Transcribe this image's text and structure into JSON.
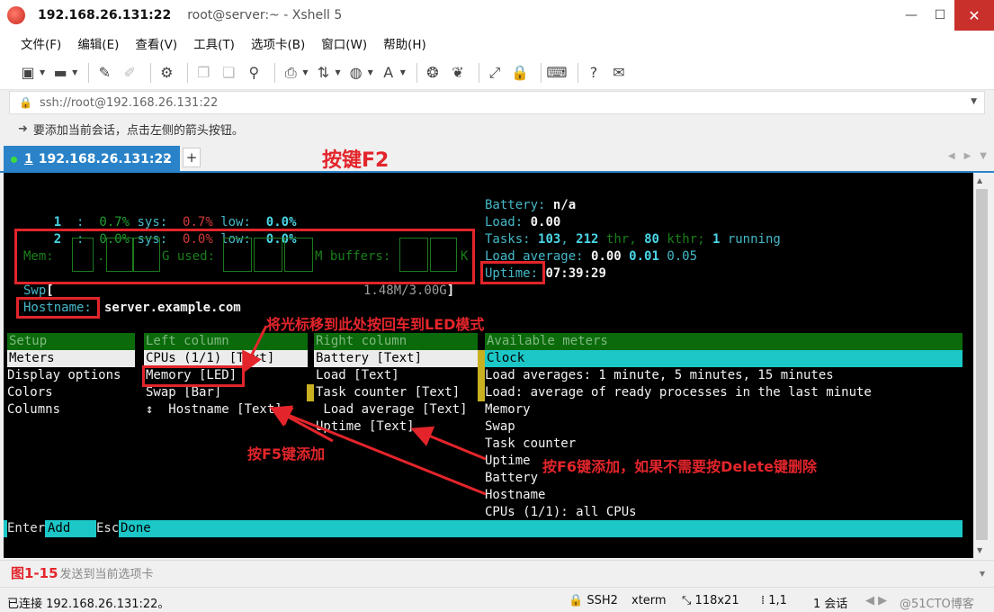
{
  "window": {
    "title_ip": "192.168.26.131:22",
    "title_rest": "root@server:~ - Xshell 5",
    "minimize": "—",
    "maximize": "☐",
    "close": "✕"
  },
  "menu": [
    "文件(F)",
    "编辑(E)",
    "查看(V)",
    "工具(T)",
    "选项卡(B)",
    "窗口(W)",
    "帮助(H)"
  ],
  "address": {
    "value": "ssh://root@192.168.26.131:22"
  },
  "hint": "要添加当前会话，点击左侧的箭头按钮。",
  "tab": {
    "number": "1",
    "label": "192.168.26.131:22",
    "close": "×",
    "add": "+"
  },
  "terminal": {
    "cpu1": {
      "idx": "1",
      "pct": "0.7%",
      "sys_label": "sys:",
      "sys_val": "0.7%",
      "low_label": "low:",
      "low_val": "0.0%"
    },
    "cpu2": {
      "idx": "2",
      "pct": "0.0%",
      "sys_label": "sys:",
      "sys_val": "0.0%",
      "low_label": "low:",
      "low_val": "0.0%"
    },
    "mem": {
      "label": "Mem:",
      "used_label": "G used:",
      "buffers_label": "M buffers:"
    },
    "swap": {
      "label": "Swp",
      "value": "1.48M/3.00G"
    },
    "hostname": {
      "label": "Hostname:",
      "value": "server.example.com"
    },
    "right": {
      "battery_label": "Battery:",
      "battery_val": "n/a",
      "load_label": "Load:",
      "load_val": "0.00",
      "tasks_label": "Tasks:",
      "tasks_val": "103",
      "thr_val": "212",
      "thr_label": "thr,",
      "kthr_val": "80",
      "kthr_label": "kthr;",
      "running_val": "1",
      "running_label": "running",
      "loadavg_label": "Load average:",
      "loadavg_1": "0.00",
      "loadavg_5": "0.01",
      "loadavg_15": "0.05",
      "uptime_label": "Uptime:",
      "uptime_val": "07:39:29"
    },
    "setup": {
      "headers": {
        "setup": "Setup",
        "left": "Left column",
        "right": "Right column",
        "available": "Available meters"
      },
      "setup_items": [
        "Meters",
        "Display options",
        "Colors",
        "Columns"
      ],
      "left_items": [
        "CPUs (1/1) [Text]",
        "Memory [LED]",
        "Swap [Bar]",
        "↕  Hostname [Text]"
      ],
      "right_items": [
        "Battery [Text]",
        "Load [Text]",
        "Task counter [Text]",
        " Load average [Text]",
        "Uptime [Text]"
      ],
      "available_items": [
        "Clock",
        "Load averages: 1 minute, 5 minutes, 15 minutes",
        "Load: average of ready processes in the last minute",
        "Memory",
        "Swap",
        "Task counter",
        "Uptime",
        "Battery",
        "Hostname",
        "CPUs (1/1): all CPUs"
      ]
    },
    "footer": {
      "enter_key": "Enter",
      "enter_label": "Add",
      "esc_key": "Esc",
      "esc_label": "Done"
    }
  },
  "annotations": {
    "f2": "按键F2",
    "led": "将光标移到此处按回车到LED模式",
    "f5": "按F5键添加",
    "f6": "按F6键添加，如果不需要按Delete键删除",
    "figure": "图1-15"
  },
  "compose": {
    "placeholder": "发送到当前选项卡"
  },
  "status": {
    "connected": "已连接 192.168.26.131:22。",
    "protocol": "SSH2",
    "term": "xterm",
    "size": "118x21",
    "cursor": "1,1",
    "sessions": "1 会话",
    "watermark": "@51CTO博客"
  },
  "colors": {
    "accent": "#2a83c8",
    "annotation": "#e3252b",
    "term_bg": "#000000",
    "highlight": "#1cc7c7"
  }
}
